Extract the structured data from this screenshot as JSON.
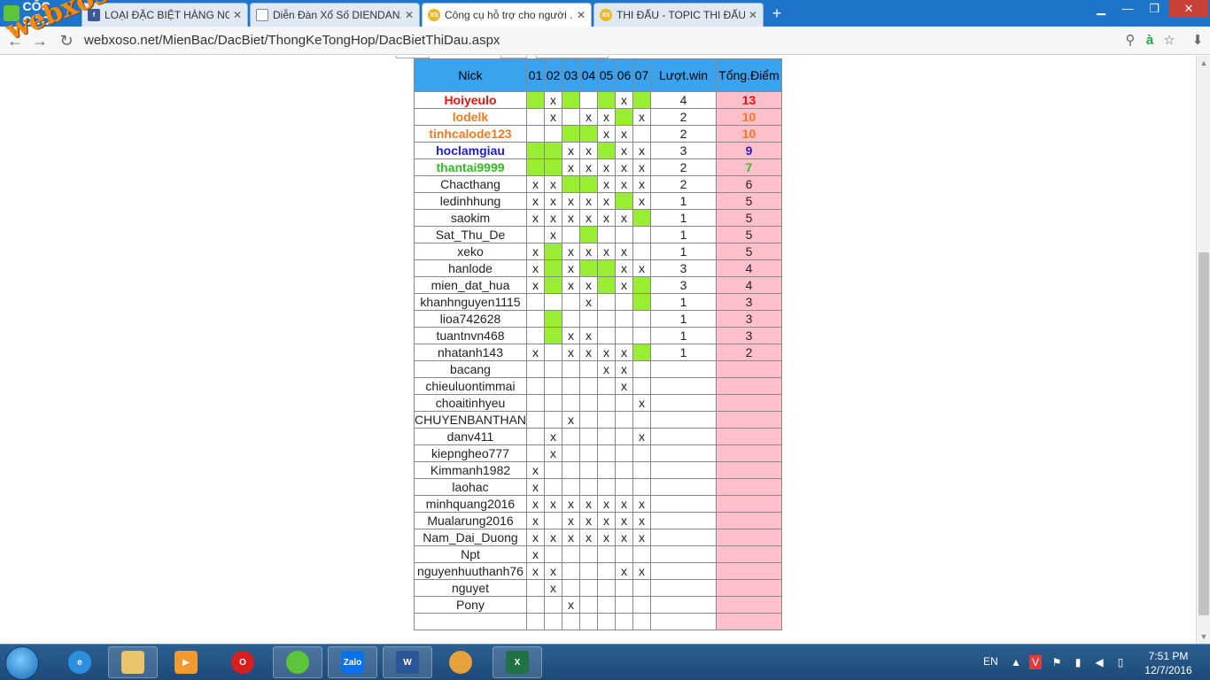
{
  "browser": {
    "brand": "CỐC CỐC",
    "tabs": [
      {
        "title": "LOẠI ĐẶC BIỆT HÀNG NG...",
        "icon": "facebook-icon",
        "active": false
      },
      {
        "title": "Diễn Đàn Xổ Số DIENDAN...",
        "icon": "page-icon",
        "active": false
      },
      {
        "title": "Công cụ hỗ trợ cho người ...",
        "icon": "xoso-icon",
        "active": true
      },
      {
        "title": "THI ĐẤU - TOPIC THI ĐẤU...",
        "icon": "xoso-icon",
        "active": false
      }
    ],
    "url": "webxoso.net/MienBac/DacBiet/ThongKeTongHop/DacBietThiDau.aspx",
    "watermark": "webxoso.net"
  },
  "table": {
    "headers": {
      "nick": "Nick",
      "days": [
        "01",
        "02",
        "03",
        "04",
        "05",
        "06",
        "07"
      ],
      "wins": "Lượt.win",
      "points": "Tổng.Điểm"
    },
    "rows": [
      {
        "nick": "Hoiyeulo",
        "style": "red",
        "days": [
          "G",
          "x",
          "G",
          "",
          "G",
          "x",
          "G"
        ],
        "wins": "4",
        "points": "13"
      },
      {
        "nick": "lodelk",
        "style": "orange",
        "days": [
          "",
          "x",
          "",
          "x",
          "x",
          "G",
          "x"
        ],
        "wins": "2",
        "points": "10"
      },
      {
        "nick": "tinhcalode123",
        "style": "orange",
        "days": [
          "",
          "",
          "G",
          "G",
          "x",
          "x",
          ""
        ],
        "wins": "2",
        "points": "10"
      },
      {
        "nick": "hoclamgiau",
        "style": "blue",
        "days": [
          "G",
          "G",
          "x",
          "x",
          "G",
          "x",
          "x"
        ],
        "wins": "3",
        "points": "9"
      },
      {
        "nick": "thantai9999",
        "style": "green",
        "days": [
          "G",
          "G",
          "x",
          "x",
          "x",
          "x",
          "x"
        ],
        "wins": "2",
        "points": "7"
      },
      {
        "nick": "Chacthang",
        "style": "",
        "days": [
          "x",
          "x",
          "G",
          "G",
          "x",
          "x",
          "x"
        ],
        "wins": "2",
        "points": "6"
      },
      {
        "nick": "ledinhhung",
        "style": "",
        "days": [
          "x",
          "x",
          "x",
          "x",
          "x",
          "G",
          "x"
        ],
        "wins": "1",
        "points": "5"
      },
      {
        "nick": "saokim",
        "style": "",
        "days": [
          "x",
          "x",
          "x",
          "x",
          "x",
          "x",
          "G"
        ],
        "wins": "1",
        "points": "5"
      },
      {
        "nick": "Sat_Thu_De",
        "style": "",
        "days": [
          "",
          "x",
          "",
          "G",
          "",
          "",
          ""
        ],
        "wins": "1",
        "points": "5"
      },
      {
        "nick": "xeko",
        "style": "",
        "days": [
          "x",
          "G",
          "x",
          "x",
          "x",
          "x",
          ""
        ],
        "wins": "1",
        "points": "5"
      },
      {
        "nick": "hanlode",
        "style": "",
        "days": [
          "x",
          "G",
          "x",
          "G",
          "G",
          "x",
          "x"
        ],
        "wins": "3",
        "points": "4"
      },
      {
        "nick": "mien_dat_hua",
        "style": "",
        "days": [
          "x",
          "G",
          "x",
          "x",
          "G",
          "x",
          "G"
        ],
        "wins": "3",
        "points": "4"
      },
      {
        "nick": "khanhnguyen1115",
        "style": "",
        "days": [
          "",
          "",
          "",
          "x",
          "",
          "",
          "G"
        ],
        "wins": "1",
        "points": "3"
      },
      {
        "nick": "lioa742628",
        "style": "",
        "days": [
          "",
          "G",
          "",
          "",
          "",
          "",
          ""
        ],
        "wins": "1",
        "points": "3"
      },
      {
        "nick": "tuantnvn468",
        "style": "",
        "days": [
          "",
          "G",
          "x",
          "x",
          "",
          "",
          ""
        ],
        "wins": "1",
        "points": "3"
      },
      {
        "nick": "nhatanh143",
        "style": "",
        "days": [
          "x",
          "",
          "x",
          "x",
          "x",
          "x",
          "G"
        ],
        "wins": "1",
        "points": "2"
      },
      {
        "nick": "bacang",
        "style": "",
        "days": [
          "",
          "",
          "",
          "",
          "x",
          "x",
          ""
        ],
        "wins": "",
        "points": ""
      },
      {
        "nick": "chieuluontimmai",
        "style": "",
        "days": [
          "",
          "",
          "",
          "",
          "",
          "x",
          ""
        ],
        "wins": "",
        "points": ""
      },
      {
        "nick": "choaitinhyeu",
        "style": "",
        "days": [
          "",
          "",
          "",
          "",
          "",
          "",
          "x"
        ],
        "wins": "",
        "points": ""
      },
      {
        "nick": "CHUYENBANTHAN",
        "style": "",
        "days": [
          "",
          "",
          "x",
          "",
          "",
          "",
          ""
        ],
        "wins": "",
        "points": ""
      },
      {
        "nick": "danv411",
        "style": "",
        "days": [
          "",
          "x",
          "",
          "",
          "",
          "",
          "x"
        ],
        "wins": "",
        "points": ""
      },
      {
        "nick": "kiepngheo777",
        "style": "",
        "days": [
          "",
          "x",
          "",
          "",
          "",
          "",
          ""
        ],
        "wins": "",
        "points": ""
      },
      {
        "nick": "Kimmanh1982",
        "style": "",
        "days": [
          "x",
          "",
          "",
          "",
          "",
          "",
          ""
        ],
        "wins": "",
        "points": ""
      },
      {
        "nick": "laohac",
        "style": "",
        "days": [
          "x",
          "",
          "",
          "",
          "",
          "",
          ""
        ],
        "wins": "",
        "points": ""
      },
      {
        "nick": "minhquang2016",
        "style": "",
        "days": [
          "x",
          "x",
          "x",
          "x",
          "x",
          "x",
          "x"
        ],
        "wins": "",
        "points": ""
      },
      {
        "nick": "Mualarung2016",
        "style": "",
        "days": [
          "x",
          "",
          "x",
          "x",
          "x",
          "x",
          "x"
        ],
        "wins": "",
        "points": ""
      },
      {
        "nick": "Nam_Dai_Duong",
        "style": "",
        "days": [
          "x",
          "x",
          "x",
          "x",
          "x",
          "x",
          "x"
        ],
        "wins": "",
        "points": ""
      },
      {
        "nick": "Npt",
        "style": "",
        "days": [
          "x",
          "",
          "",
          "",
          "",
          "",
          ""
        ],
        "wins": "",
        "points": ""
      },
      {
        "nick": "nguyenhuuthanh76",
        "style": "",
        "days": [
          "x",
          "x",
          "",
          "",
          "",
          "x",
          "x"
        ],
        "wins": "",
        "points": ""
      },
      {
        "nick": "nguyet",
        "style": "",
        "days": [
          "",
          "x",
          "",
          "",
          "",
          "",
          ""
        ],
        "wins": "",
        "points": ""
      },
      {
        "nick": "Pony",
        "style": "",
        "days": [
          "",
          "",
          "x",
          "",
          "",
          "",
          ""
        ],
        "wins": "",
        "points": ""
      },
      {
        "nick": "",
        "style": "",
        "days": [
          "",
          "",
          "",
          "",
          "",
          "",
          ""
        ],
        "wins": "",
        "points": ""
      }
    ]
  },
  "colors": {
    "header_bg": "#3aa3f0",
    "win_cell": "#99ee33",
    "points_col": "#ffc0cb"
  },
  "taskbar": {
    "apps": [
      "ie-icon",
      "explorer-icon",
      "media-icon",
      "opera-icon",
      "coccoc-icon",
      "zalo-icon",
      "word-icon",
      "paint-icon",
      "excel-icon"
    ],
    "zalo_label": "Zalo",
    "lang": "EN",
    "time": "7:51 PM",
    "date": "12/7/2016"
  }
}
